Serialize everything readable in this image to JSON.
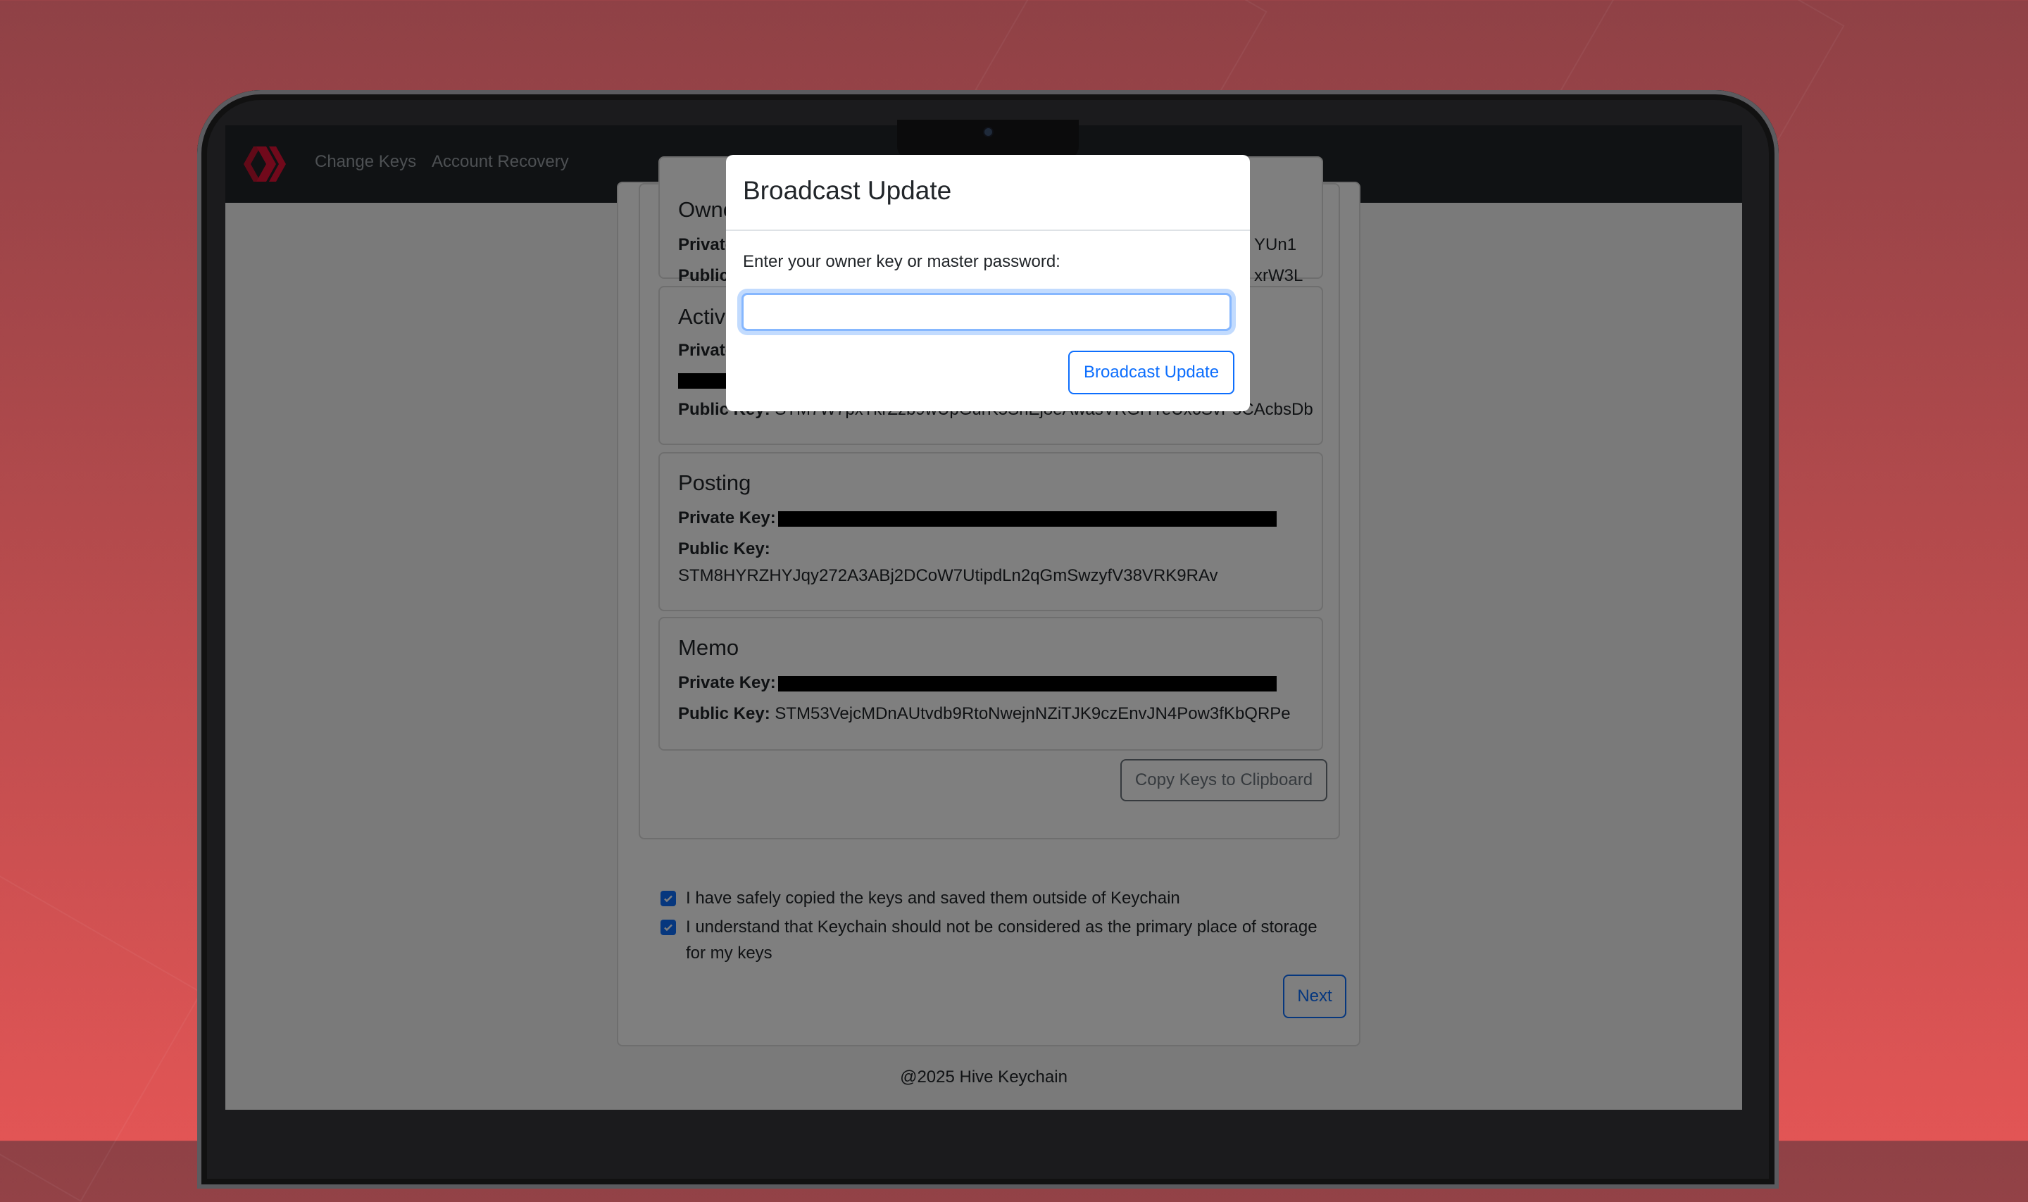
{
  "navbar": {
    "links": [
      "Change Keys",
      "Account Recovery"
    ]
  },
  "modal": {
    "title": "Broadcast Update",
    "label": "Enter your owner key or master password:",
    "input_value": "",
    "button": "Broadcast Update"
  },
  "keys": {
    "owner": {
      "title": "Owner",
      "private_label": "Private Key:",
      "private_tail": "YUn1",
      "public_label": "Public Key:",
      "public_tail": "xrW3L"
    },
    "active": {
      "title": "Active",
      "private_label": "Private Key:",
      "public_label": "Public Key:",
      "public_value": "STM7W7pxTkrZzb9wUpGurK5ShEj8eAwasVRGHYeUx6SvP5CAcbsDb"
    },
    "posting": {
      "title": "Posting",
      "private_label": "Private Key:",
      "public_label": "Public Key:",
      "public_value": "STM8HYRZHYJqy272A3ABj2DCoW7UtipdLn2qGmSwzyfV38VRK9RAv"
    },
    "memo": {
      "title": "Memo",
      "private_label": "Private Key:",
      "public_label": "Public Key:",
      "public_value": "STM53VejcMDnAUtvdb9RtoNwejnNZiTJK9czEnvJN4Pow3fKbQRPe"
    }
  },
  "copy_button": "Copy Keys to Clipboard",
  "checkboxes": [
    {
      "label": "I have safely copied the keys and saved them outside of Keychain",
      "checked": true
    },
    {
      "label": "I understand that Keychain should not be considered as the primary place of storage for my keys",
      "checked": true
    }
  ],
  "next_button": "Next",
  "footer": "@2025 Hive Keychain",
  "colors": {
    "brand_red": "#e31337",
    "primary": "#0d6efd",
    "background": "#e25555"
  }
}
